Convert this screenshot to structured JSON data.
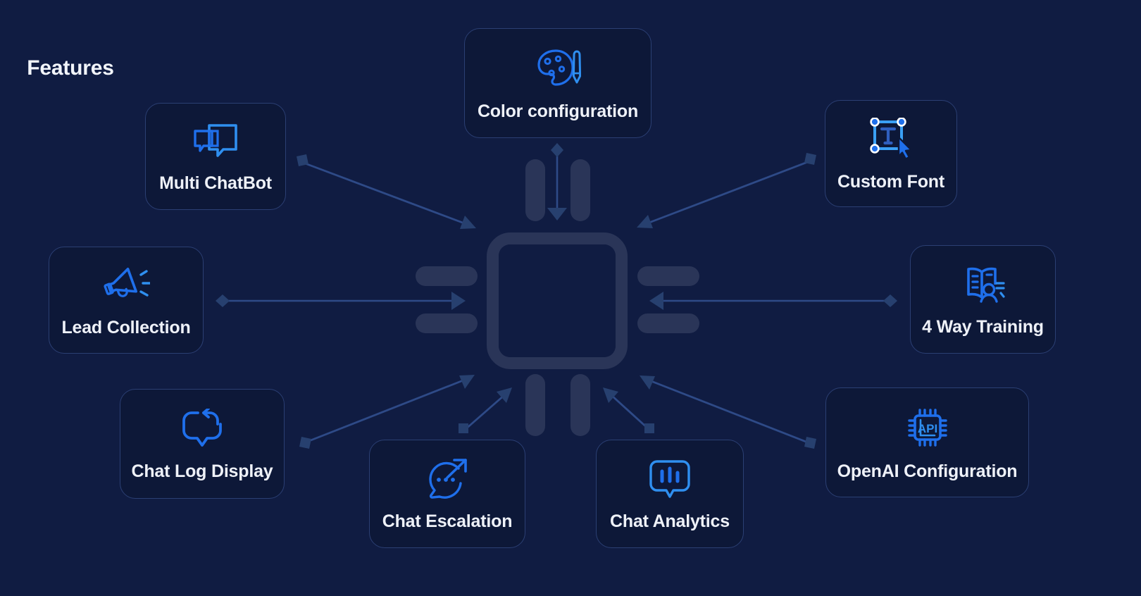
{
  "theme": {
    "background": "#101c42",
    "card_background": "#0d1838",
    "card_border": "#2b3f73",
    "icon_accent": "#1f6feb",
    "icon_accent_light": "#3aa0f5",
    "text_primary": "#eef1f8",
    "chip_color": "#2a3558",
    "connector_color": "#2e4a87",
    "marker_color": "#27406f"
  },
  "center": {
    "label": "Features",
    "icon": "cpu-chip-icon"
  },
  "cards": [
    {
      "id": "color-configuration",
      "label": "Color configuration",
      "icon": "color-palette-icon"
    },
    {
      "id": "multi-chatbot",
      "label": "Multi ChatBot",
      "icon": "multi-chat-bubbles-icon"
    },
    {
      "id": "custom-font",
      "label": "Custom Font",
      "icon": "text-selection-cursor-icon"
    },
    {
      "id": "lead-collection",
      "label": "Lead Collection",
      "icon": "megaphone-icon"
    },
    {
      "id": "4-way-training",
      "label": "4 Way Training",
      "icon": "book-person-icon"
    },
    {
      "id": "chat-log-display",
      "label": "Chat Log Display",
      "icon": "chat-bubble-refresh-icon"
    },
    {
      "id": "chat-escalation",
      "label": "Chat Escalation",
      "icon": "chat-bubble-expand-arrow-icon"
    },
    {
      "id": "chat-analytics",
      "label": "Chat Analytics",
      "icon": "chat-bubble-bar-chart-icon"
    },
    {
      "id": "openai-configuration",
      "label": "OpenAI Configuration",
      "icon": "api-chip-icon"
    }
  ],
  "connectors": [
    {
      "from": "color-configuration",
      "to": "center",
      "direction": "down",
      "start_marker": "diamond",
      "end_marker": "arrow"
    },
    {
      "from": "multi-chatbot",
      "to": "center",
      "direction": "down-right",
      "start_marker": "square",
      "end_marker": "arrow"
    },
    {
      "from": "custom-font",
      "to": "center",
      "direction": "down-left",
      "start_marker": "square",
      "end_marker": "arrow"
    },
    {
      "from": "lead-collection",
      "to": "center",
      "direction": "right",
      "start_marker": "diamond",
      "end_marker": "arrow"
    },
    {
      "from": "4-way-training",
      "to": "center",
      "direction": "left",
      "start_marker": "diamond",
      "end_marker": "arrow"
    },
    {
      "from": "chat-log-display",
      "to": "center",
      "direction": "up-right",
      "start_marker": "square",
      "end_marker": "arrow"
    },
    {
      "from": "chat-escalation",
      "to": "center",
      "direction": "up-right",
      "start_marker": "square",
      "end_marker": "arrow"
    },
    {
      "from": "chat-analytics",
      "to": "center",
      "direction": "up-left",
      "start_marker": "square",
      "end_marker": "arrow"
    },
    {
      "from": "openai-configuration",
      "to": "center",
      "direction": "up-left",
      "start_marker": "square",
      "end_marker": "arrow"
    }
  ]
}
